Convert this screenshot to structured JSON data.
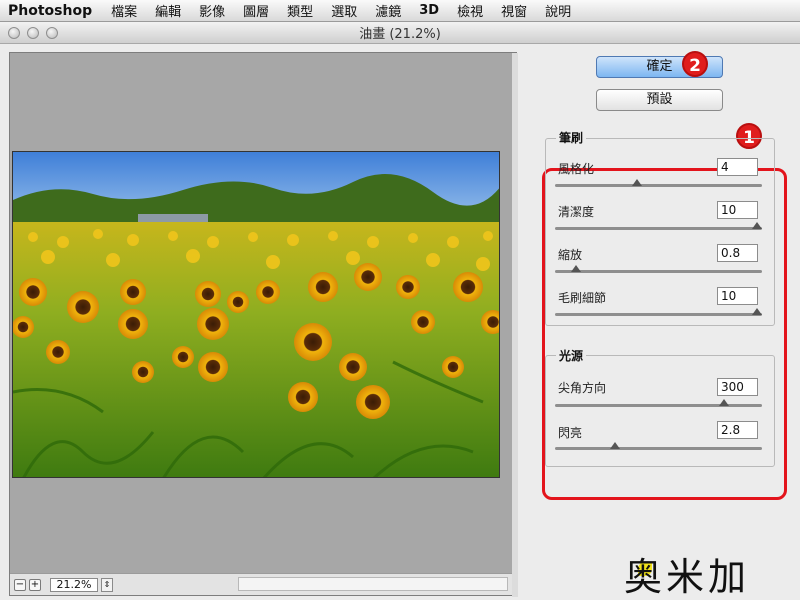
{
  "menubar": {
    "app_name": "Photoshop",
    "items": [
      "檔案",
      "編輯",
      "影像",
      "圖層",
      "類型",
      "選取",
      "濾鏡",
      "3D",
      "檢視",
      "視窗",
      "說明"
    ]
  },
  "dialog": {
    "title": "油畫 (21.2%)",
    "ok_label": "確定",
    "preset_label": "預設",
    "badge_1": "1",
    "badge_2": "2"
  },
  "brush": {
    "title": "筆刷",
    "stylization": {
      "label": "風格化",
      "value": "4",
      "level": 0.39
    },
    "cleanliness": {
      "label": "清潔度",
      "value": "10",
      "level": 1.0
    },
    "scale": {
      "label": "縮放",
      "value": "0.8",
      "level": 0.08
    },
    "bristle_detail": {
      "label": "毛刷細節",
      "value": "10",
      "level": 1.0
    }
  },
  "lighting": {
    "title": "光源",
    "angular_direction": {
      "label": "尖角方向",
      "value": "300",
      "level": 0.83
    },
    "shine": {
      "label": "閃亮",
      "value": "2.8",
      "level": 0.28
    }
  },
  "preview": {
    "zoom_value": "21.2%",
    "zoom_out": "−",
    "zoom_in": "+"
  },
  "watermark": {
    "text": "奥米加"
  },
  "colors": {
    "accent": "#e3141c",
    "primary_button": "#7db6f1"
  }
}
